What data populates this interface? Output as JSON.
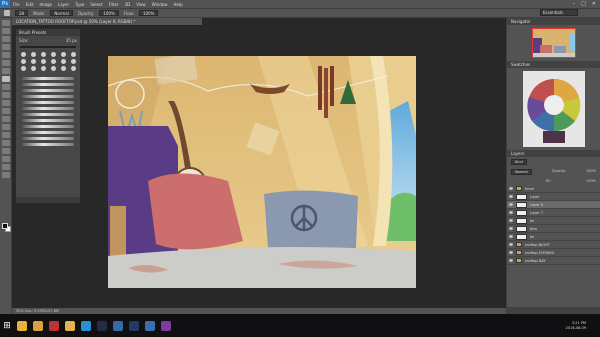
{
  "menubar": {
    "logo": "Ps",
    "items": [
      "File",
      "Edit",
      "Image",
      "Layer",
      "Type",
      "Select",
      "Filter",
      "3D",
      "View",
      "Window",
      "Help"
    ],
    "window_controls": [
      "–",
      "□",
      "✕"
    ]
  },
  "options_bar": {
    "brush_size": "28",
    "mode_label": "Mode:",
    "mode_value": "Normal",
    "opacity_label": "Opacity:",
    "opacity_value": "100%",
    "flow_label": "Flow:",
    "flow_value": "100%",
    "workspace": "Essentials"
  },
  "document_tab": {
    "title": "LOCATION_TATTOO ROOFTOP.psd @ 50% (Layer 8, RGB/8) *"
  },
  "brush_panel": {
    "title": "Brush Presets",
    "size_label": "Size:",
    "size_value": "35 px",
    "tip_count": 18,
    "stroke_count": 12
  },
  "status_bar": {
    "text": "50%    Doc: 5.93M/107.6M"
  },
  "panels": {
    "navigator": {
      "title": "Navigator",
      "zoom": "50%"
    },
    "swatches": {
      "title": "Swatches"
    },
    "layers": {
      "title": "Layers",
      "kind_label": "Kind",
      "blend_mode": "Normal",
      "opacity_label": "Opacity:",
      "opacity_value": "100%",
      "fill_label": "Fill:",
      "fill_value": "100%",
      "items": [
        {
          "name": "hmm",
          "kind": "folder",
          "selected": false
        },
        {
          "name": "Layer",
          "kind": "layer",
          "selected": false
        },
        {
          "name": "Layer 8",
          "kind": "layer",
          "selected": true
        },
        {
          "name": "Layer 7",
          "kind": "layer",
          "selected": false
        },
        {
          "name": "bk",
          "kind": "layer",
          "selected": false
        },
        {
          "name": "bkw",
          "kind": "layer",
          "selected": false
        },
        {
          "name": "bk",
          "kind": "layer",
          "selected": false
        },
        {
          "name": "rooftop NIGHT",
          "kind": "folder",
          "selected": false
        },
        {
          "name": "rooftop EVENING",
          "kind": "folder",
          "selected": false
        },
        {
          "name": "rooftop DAY",
          "kind": "folder",
          "selected": false
        }
      ]
    }
  },
  "taskbar": {
    "start_glyph": "⊞",
    "apps": [
      {
        "name": "chrome",
        "color": "#e8b13a"
      },
      {
        "name": "explorer",
        "color": "#d9a23f"
      },
      {
        "name": "media",
        "color": "#bb3333"
      },
      {
        "name": "folder",
        "color": "#e3b54b"
      },
      {
        "name": "skype",
        "color": "#2a8fd6"
      },
      {
        "name": "steam",
        "color": "#222c44"
      },
      {
        "name": "editor",
        "color": "#356aa8"
      },
      {
        "name": "photoshop",
        "color": "#1f3b66"
      },
      {
        "name": "app",
        "color": "#3d6fb0"
      },
      {
        "name": "app2",
        "color": "#7d3aa0"
      }
    ],
    "time": "3:21 PM",
    "date": "2016-08-09"
  },
  "colors": {
    "canvas_wall": "#e3be79",
    "window_sky": "#8fc7e6",
    "pillow_pink": "#cc6e6e",
    "pillow_blue": "#8a99b0",
    "blanket_purple": "#5a3b86",
    "floor": "#ccccc9"
  }
}
